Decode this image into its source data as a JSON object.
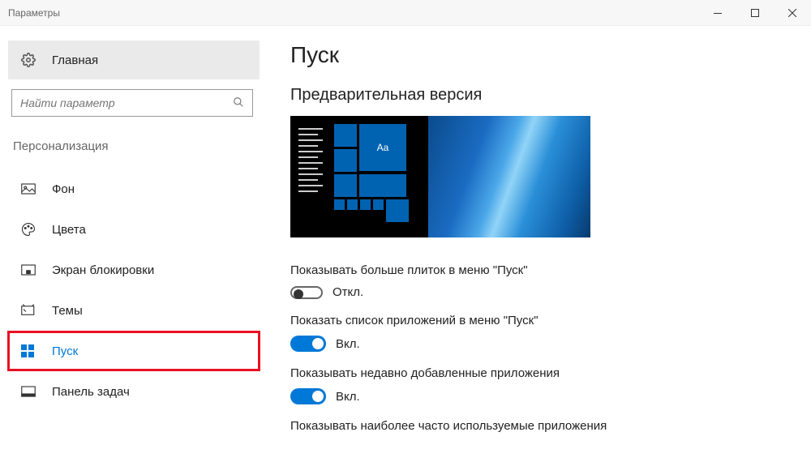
{
  "window": {
    "title": "Параметры"
  },
  "sidebar": {
    "home": "Главная",
    "search_placeholder": "Найти параметр",
    "section": "Персонализация",
    "items": [
      {
        "label": "Фон"
      },
      {
        "label": "Цвета"
      },
      {
        "label": "Экран блокировки"
      },
      {
        "label": "Темы"
      },
      {
        "label": "Пуск"
      },
      {
        "label": "Панель задач"
      }
    ]
  },
  "main": {
    "title": "Пуск",
    "preview_title": "Предварительная версия",
    "preview_tile_text": "Aa",
    "settings": [
      {
        "label": "Показывать больше плиток в меню \"Пуск\"",
        "on": false,
        "state_text": "Откл."
      },
      {
        "label": "Показать список приложений в меню \"Пуск\"",
        "on": true,
        "state_text": "Вкл."
      },
      {
        "label": "Показывать недавно добавленные приложения",
        "on": true,
        "state_text": "Вкл."
      },
      {
        "label": "Показывать наиболее часто используемые приложения",
        "on": null,
        "state_text": ""
      }
    ]
  }
}
